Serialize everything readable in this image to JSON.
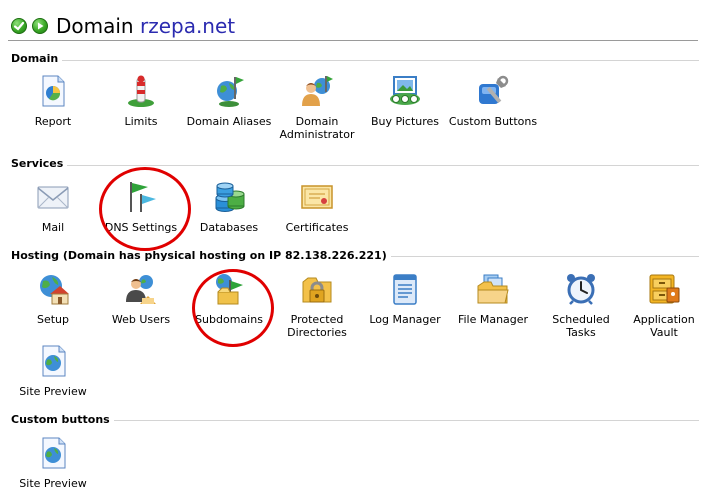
{
  "header": {
    "title_prefix": "Domain",
    "domain": "rzepa.net"
  },
  "sections": {
    "domain": {
      "title": "Domain",
      "items": [
        {
          "label": "Report",
          "icon": "report-icon"
        },
        {
          "label": "Limits",
          "icon": "limits-icon"
        },
        {
          "label": "Domain Aliases",
          "icon": "domain-aliases-icon"
        },
        {
          "label": "Domain Administrator",
          "icon": "domain-administrator-icon"
        },
        {
          "label": "Buy Pictures",
          "icon": "buy-pictures-icon"
        },
        {
          "label": "Custom Buttons",
          "icon": "custom-buttons-icon"
        }
      ]
    },
    "services": {
      "title": "Services",
      "items": [
        {
          "label": "Mail",
          "icon": "mail-icon"
        },
        {
          "label": "DNS Settings",
          "icon": "dns-settings-icon"
        },
        {
          "label": "Databases",
          "icon": "databases-icon"
        },
        {
          "label": "Certificates",
          "icon": "certificates-icon"
        }
      ]
    },
    "hosting": {
      "title": "Hosting (Domain has physical hosting on IP 82.138.226.221)",
      "items": [
        {
          "label": "Setup",
          "icon": "setup-icon"
        },
        {
          "label": "Web Users",
          "icon": "web-users-icon"
        },
        {
          "label": "Subdomains",
          "icon": "subdomains-icon"
        },
        {
          "label": "Protected Directories",
          "icon": "protected-directories-icon"
        },
        {
          "label": "Log Manager",
          "icon": "log-manager-icon"
        },
        {
          "label": "File Manager",
          "icon": "file-manager-icon"
        },
        {
          "label": "Scheduled Tasks",
          "icon": "scheduled-tasks-icon"
        },
        {
          "label": "Application Vault",
          "icon": "application-vault-icon"
        },
        {
          "label": "Site Preview",
          "icon": "site-preview-icon"
        }
      ]
    },
    "custom": {
      "title": "Custom buttons",
      "items": [
        {
          "label": "Site Preview",
          "icon": "site-preview-icon"
        }
      ]
    }
  },
  "colors": {
    "domain_name": "#2b2bb0",
    "highlight_circle": "#e00000",
    "nav_button": "#3aa826"
  }
}
